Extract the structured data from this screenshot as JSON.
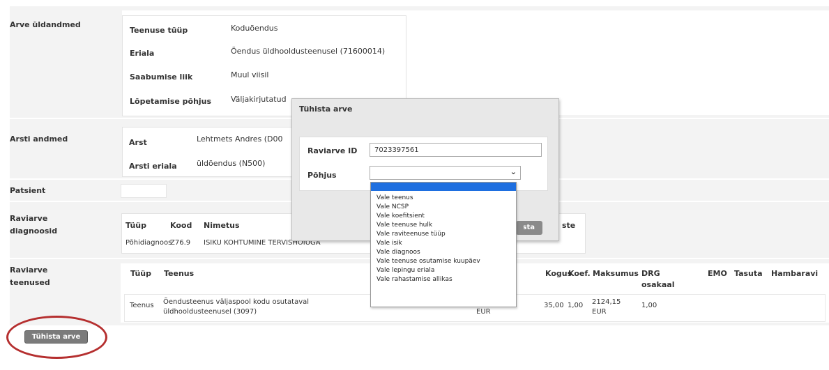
{
  "general": {
    "section_label": "Arve üldandmed",
    "rows": [
      {
        "label": "Teenuse tüüp",
        "value": "Koduõendus"
      },
      {
        "label": "Eriala",
        "value": "Õendus üldhooldusteenusel (71600014)"
      },
      {
        "label": "Saabumise liik",
        "value": "Muul viisil"
      },
      {
        "label": "Lõpetamise põhjus",
        "value": "Väljakirjutatud"
      }
    ]
  },
  "doctor": {
    "section_label": "Arsti andmed",
    "rows": [
      {
        "label": "Arst",
        "value": "Lehtmets Andres (D00"
      },
      {
        "label": "Arsti eriala",
        "value": "üldõendus (N500)"
      }
    ]
  },
  "patient": {
    "section_label": "Patsient"
  },
  "diagnoses": {
    "section_label_1": "Raviarve",
    "section_label_2": "diagnoosid",
    "headers": [
      "Tüüp",
      "Kood",
      "Nimetus",
      "ste"
    ],
    "row": {
      "type": "Põhidiagnoos",
      "code": "Z76.9",
      "name": "ISIKU KOHTUMINE TERVISHOIUGA"
    }
  },
  "services": {
    "section_label_1": "Raviarve",
    "section_label_2": "teenused",
    "headers": [
      "Tüüp",
      "Teenus",
      "Kogus",
      "Koef.",
      "Maksumus",
      "DRG",
      "osakaal",
      "EMO",
      "Tasuta",
      "Hambaravi"
    ],
    "row": {
      "type": "Teenus",
      "service_1": "Õendusteenus väljaspool kodu osutataval",
      "service_2": "üldhooldusteenusel (3097)",
      "unit": "EUR",
      "qty": "35,00",
      "coef": "1,00",
      "cost_1": "2124,15",
      "cost_2": "EUR",
      "drg": "1,00"
    }
  },
  "cancel_button": {
    "label": "Tühista arve"
  },
  "dialog": {
    "title": "Tühista arve",
    "id_label": "Raviarve ID",
    "id_value": "7023397561",
    "reason_label": "Põhjus",
    "reason_value": "",
    "ok_label": "Salvesta"
  },
  "reason_options": [
    "Vale teenus",
    "Vale NCSP",
    "Vale koefitsient",
    "Vale teenuse hulk",
    "Vale raviteenuse tüüp",
    "Vale isik",
    "Vale diagnoos",
    "Vale teenuse osutamise kuupäev",
    "Vale lepingu eriala",
    "Vale rahastamise allikas"
  ],
  "colors": {
    "highlight_oval": "#b52f2f",
    "dropdown_selection": "#1e6fe0",
    "section_bg": "#f3f3f3"
  }
}
